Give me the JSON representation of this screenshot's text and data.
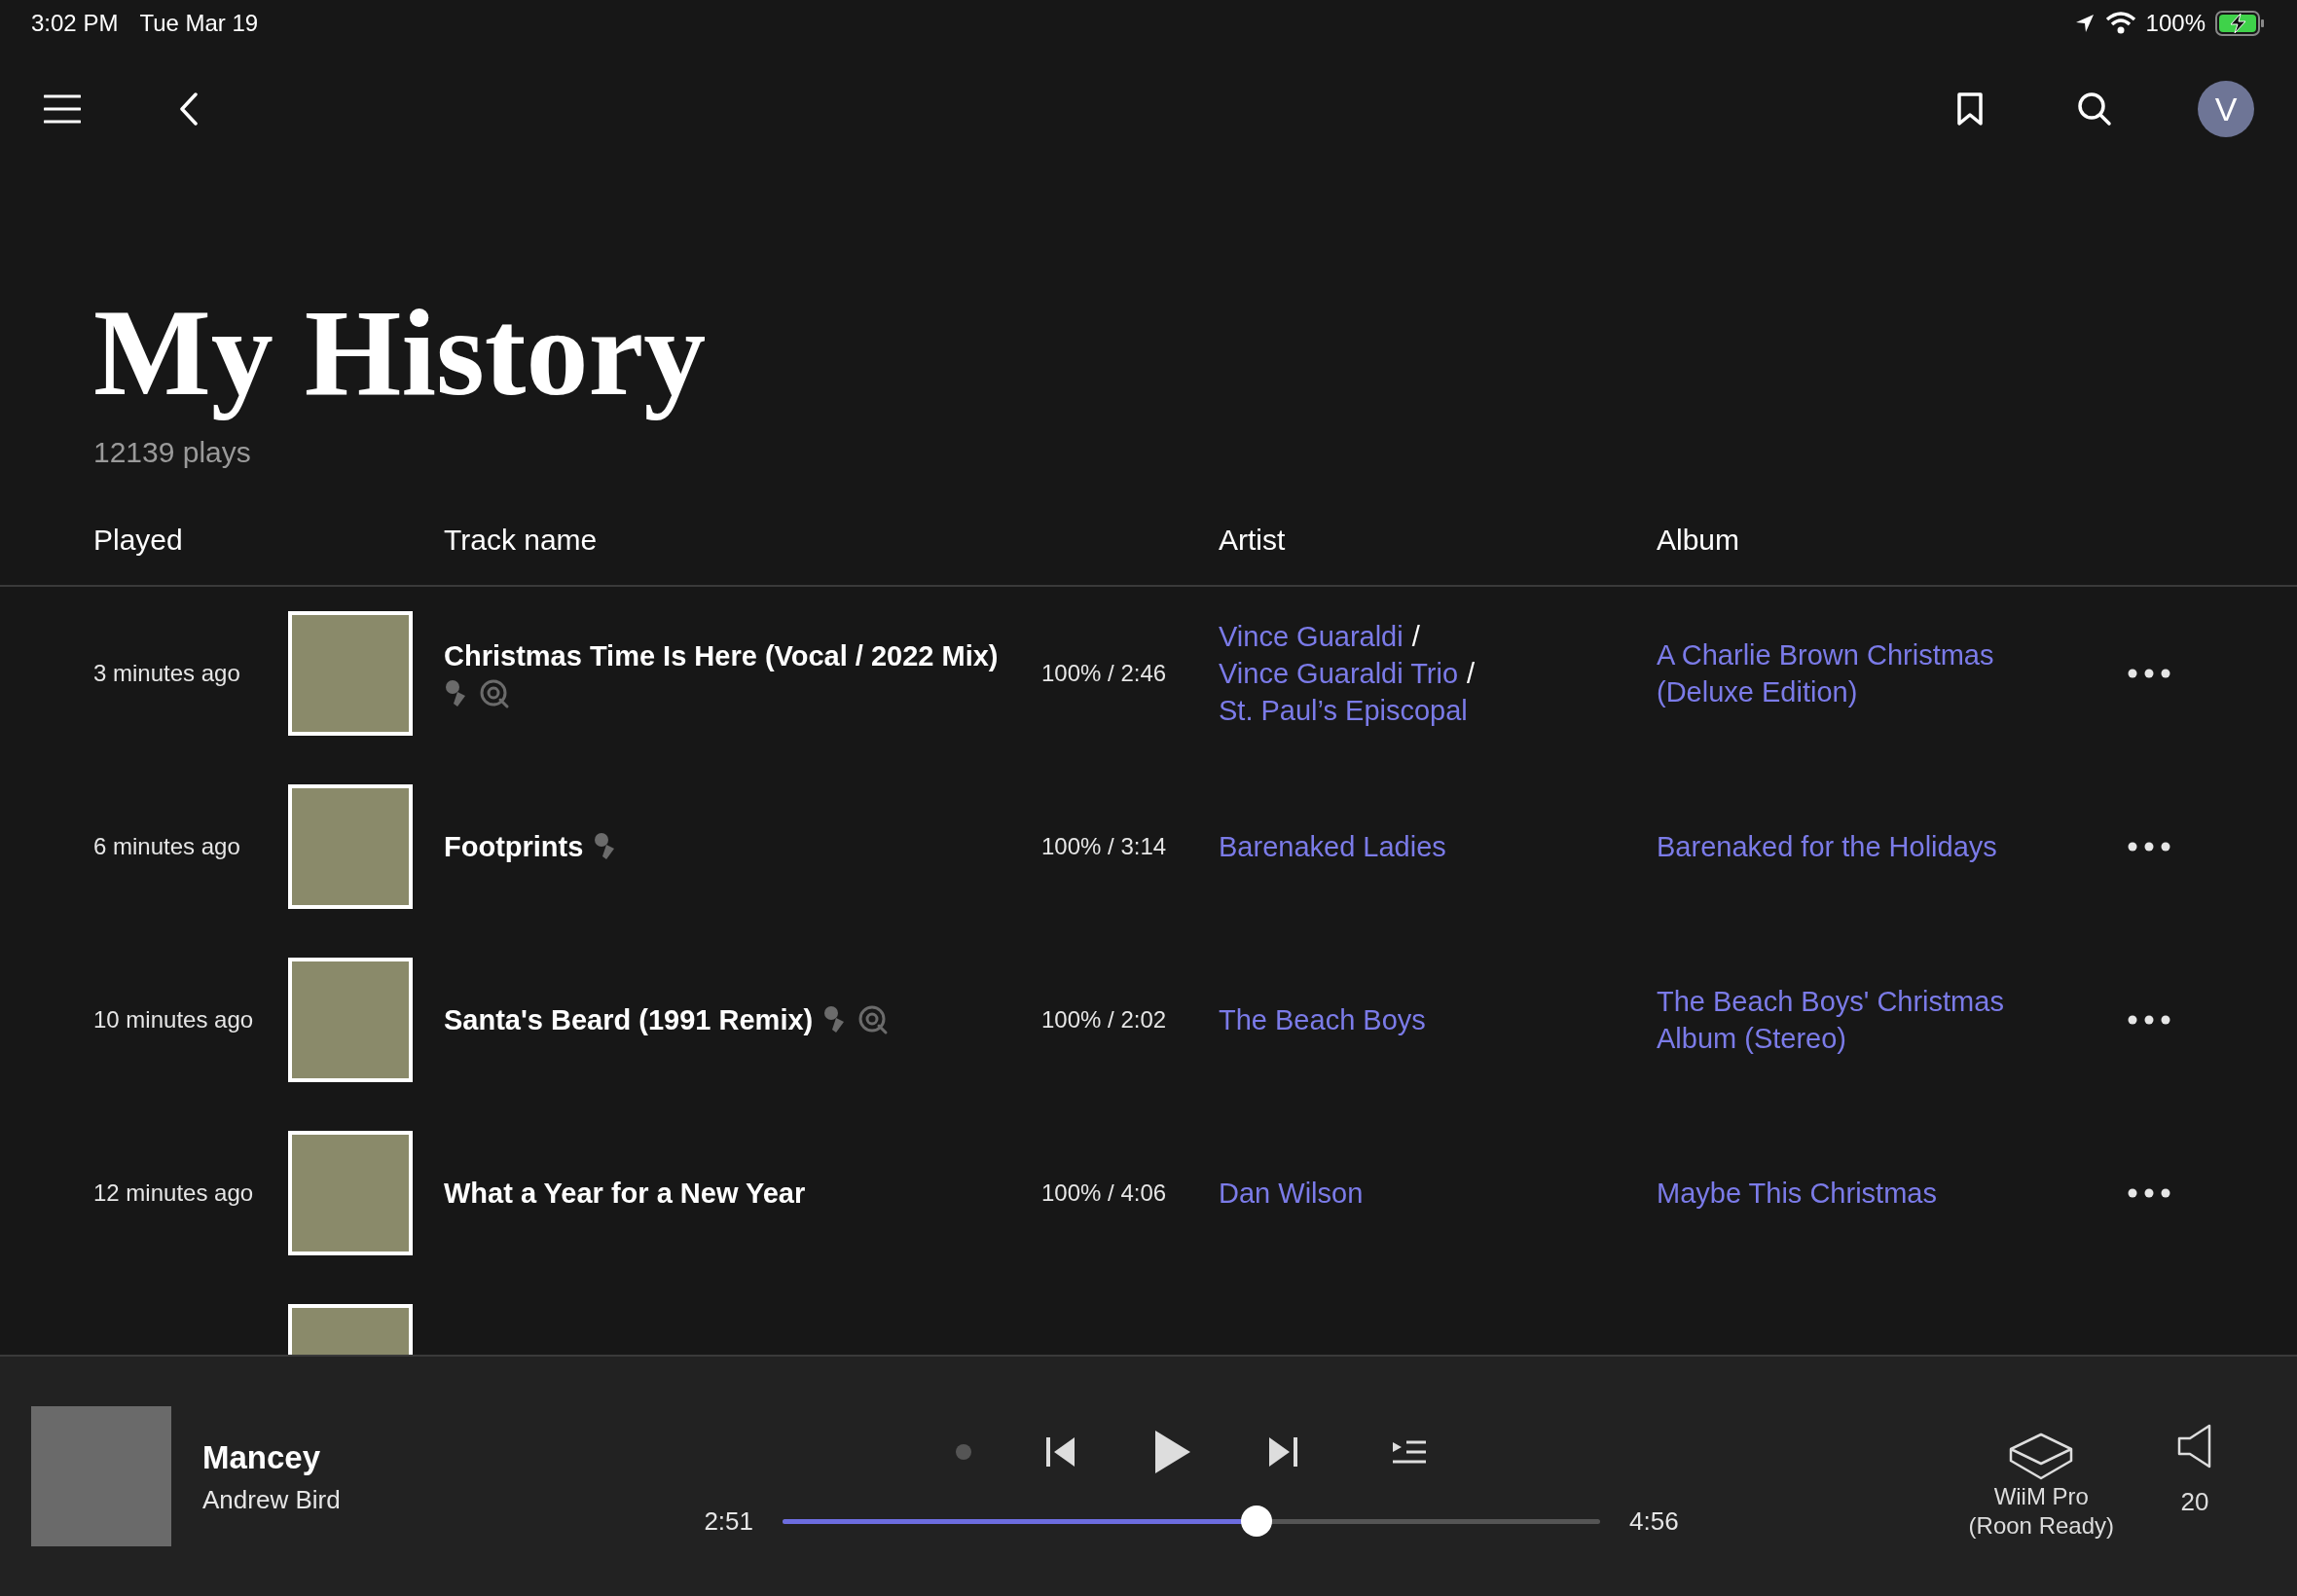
{
  "status_bar": {
    "time": "3:02 PM",
    "date": "Tue Mar 19",
    "battery": "100%",
    "charging": true
  },
  "header": {
    "avatar": "V"
  },
  "page": {
    "title": "My History",
    "subtitle": "12139 plays"
  },
  "table": {
    "columns": [
      "Played",
      "Track name",
      "Artist",
      "Album"
    ],
    "rows": [
      {
        "kind": "track",
        "played": "3 minutes ago",
        "track": "Christmas Time Is Here (Vocal / 2022 Mix)",
        "badges": [
          {
            "kind": "mic"
          },
          {
            "kind": "disc"
          }
        ],
        "progress": "100% / 2:46",
        "artist": [
          {
            "kind": "link",
            "text": "Vince Guaraldi"
          },
          {
            "kind": "sep",
            "text": "/"
          },
          {
            "kind": "link",
            "text": "Vince Guaraldi Trio"
          },
          {
            "kind": "sep",
            "text": "/"
          },
          {
            "kind": "link",
            "text": "St. Paul’s Episcopal"
          }
        ],
        "album": "A Charlie Brown Christmas (Deluxe Edition)"
      },
      {
        "kind": "track",
        "played": "6 minutes ago",
        "track": "Footprints",
        "badges": [
          {
            "kind": "mic"
          }
        ],
        "progress": "100% / 3:14",
        "artist": [
          {
            "kind": "link",
            "text": "Barenaked Ladies"
          }
        ],
        "album": "Barenaked for the Holidays"
      },
      {
        "kind": "track",
        "played": "10 minutes ago",
        "track": "Santa's Beard (1991 Remix)",
        "badges": [
          {
            "kind": "mic"
          },
          {
            "kind": "disc"
          }
        ],
        "progress": "100% / 2:02",
        "artist": [
          {
            "kind": "link",
            "text": "The Beach Boys"
          }
        ],
        "album": "The Beach Boys' Christmas Album (Stereo)"
      },
      {
        "kind": "track",
        "played": "12 minutes ago",
        "track": "What a Year for a New Year",
        "progress": "100% / 4:06",
        "artist": [
          {
            "kind": "link",
            "text": "Dan Wilson"
          }
        ],
        "album": "Maybe This Christmas"
      },
      {
        "kind": "cut"
      }
    ]
  },
  "player": {
    "title": "Mancey",
    "artist": "Andrew Bird",
    "elapsed": "2:51",
    "duration": "4:56",
    "level": 0.58,
    "playing": false,
    "device": [
      "WiiM Pro",
      "(Roon Ready)"
    ],
    "volume": "20"
  }
}
